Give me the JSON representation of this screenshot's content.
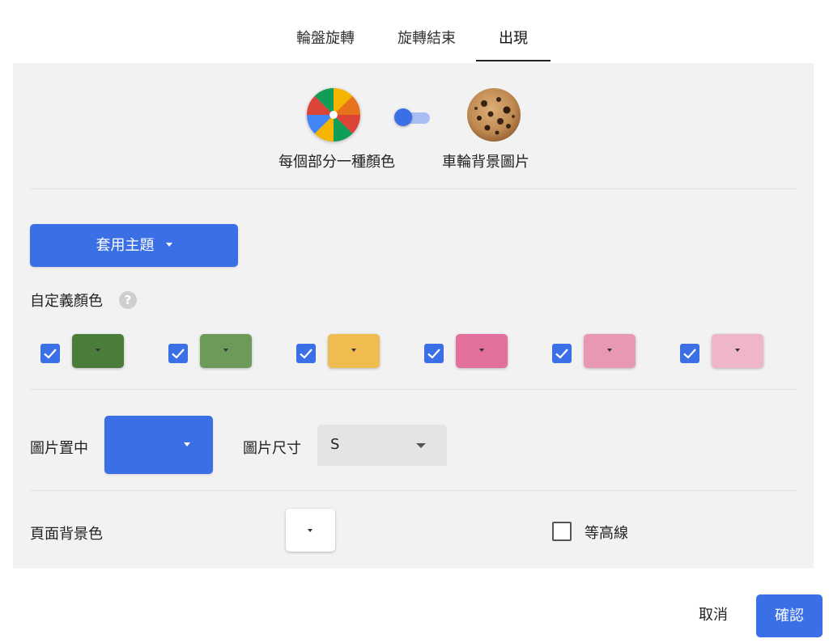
{
  "tabs": [
    {
      "label": "輪盤旋轉"
    },
    {
      "label": "旋轉結束"
    },
    {
      "label": "出現",
      "active": true
    }
  ],
  "appearance": {
    "color_per_section_label": "每個部分一種顏色",
    "wheel_background_image_label": "車輪背景圖片",
    "toggle_state": "color_per_section",
    "wheel_icon": "wheel-icon",
    "cookie_icon": "cookie-image"
  },
  "theme": {
    "button_label": "套用主題"
  },
  "custom_colors": {
    "label": "自定義顏色",
    "help": "?",
    "swatches": [
      {
        "checked": true,
        "color": "#4a7c3a"
      },
      {
        "checked": true,
        "color": "#6b9a59"
      },
      {
        "checked": true,
        "color": "#f1bc4f"
      },
      {
        "checked": true,
        "color": "#e26f9c"
      },
      {
        "checked": true,
        "color": "#e898b4"
      },
      {
        "checked": true,
        "color": "#efb5c8"
      }
    ]
  },
  "image": {
    "center_label": "圖片置中",
    "center_color": "#3b6fe6",
    "size_label": "圖片尺寸",
    "size_value": "S"
  },
  "page_background": {
    "label": "頁面背景色",
    "color": "#ffffff"
  },
  "contour": {
    "label": "等高線",
    "checked": false
  },
  "footer": {
    "cancel": "取消",
    "confirm": "確認"
  },
  "colors": {
    "accent": "#3b6fe6",
    "panel": "#f2f2f2"
  }
}
